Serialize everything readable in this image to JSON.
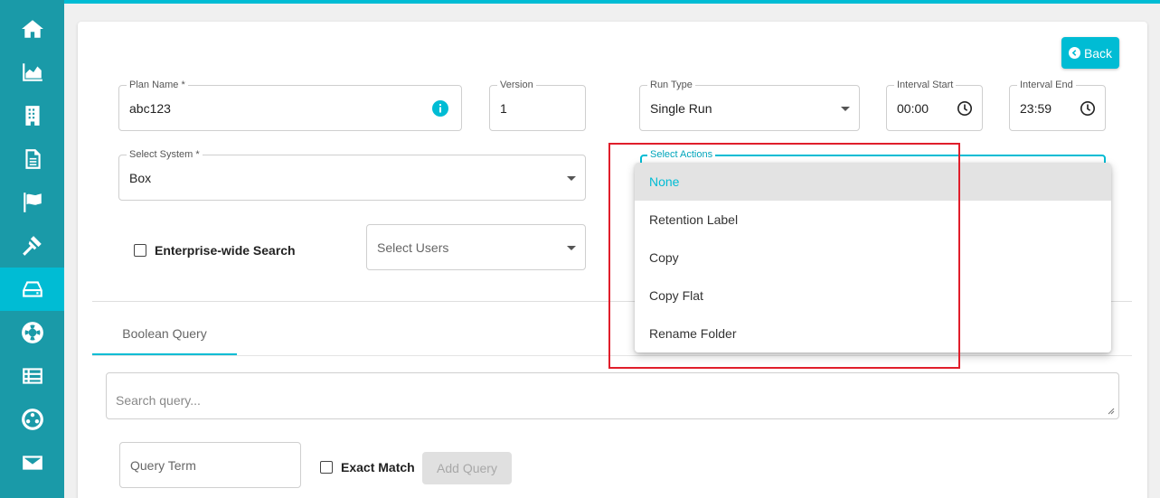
{
  "sidebar": {
    "items": [
      {
        "icon": "home-icon"
      },
      {
        "icon": "area-chart-icon"
      },
      {
        "icon": "building-icon"
      },
      {
        "icon": "document-icon"
      },
      {
        "icon": "flag-icon"
      },
      {
        "icon": "gavel-icon"
      },
      {
        "icon": "drive-icon",
        "active": true
      },
      {
        "icon": "lifebuoy-icon"
      },
      {
        "icon": "list-icon"
      },
      {
        "icon": "network-icon"
      },
      {
        "icon": "envelope-icon"
      }
    ]
  },
  "header": {
    "back_label": "Back"
  },
  "form": {
    "plan_name": {
      "label": "Plan Name *",
      "value": "abc123"
    },
    "version": {
      "label": "Version",
      "value": "1"
    },
    "run_type": {
      "label": "Run Type",
      "value": "Single Run"
    },
    "interval_start": {
      "label": "Interval Start",
      "value": "00:00"
    },
    "interval_end": {
      "label": "Interval End",
      "value": "23:59"
    },
    "select_system": {
      "label": "Select System *",
      "value": "Box"
    },
    "select_actions": {
      "label": "Select Actions"
    },
    "enterprise_search": {
      "label": "Enterprise-wide Search",
      "checked": false
    },
    "select_users": {
      "placeholder": "Select Users"
    }
  },
  "actions_dropdown": {
    "options": [
      "None",
      "Retention Label",
      "Copy",
      "Copy Flat",
      "Rename Folder"
    ],
    "selected": "None"
  },
  "tabs": [
    {
      "label": "Boolean Query",
      "active": true
    }
  ],
  "query": {
    "search_placeholder": "Search query...",
    "term_placeholder": "Query Term",
    "exact_match_label": "Exact Match",
    "add_query_label": "Add Query"
  },
  "colors": {
    "accent": "#00bcd4",
    "sidebar": "#1a9aa8",
    "highlight": "#e01e2b"
  }
}
